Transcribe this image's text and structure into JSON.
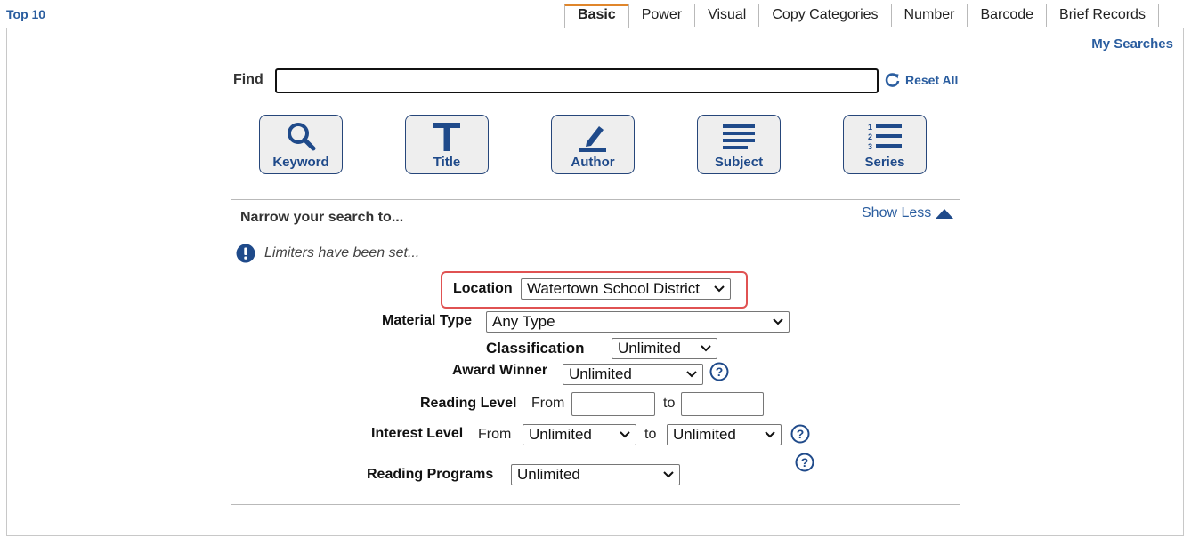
{
  "header": {
    "top10_label": "Top 10",
    "my_searches_label": "My Searches"
  },
  "tabs": [
    {
      "label": "Basic",
      "active": true
    },
    {
      "label": "Power"
    },
    {
      "label": "Visual"
    },
    {
      "label": "Copy Categories"
    },
    {
      "label": "Number"
    },
    {
      "label": "Barcode"
    },
    {
      "label": "Brief Records"
    }
  ],
  "find": {
    "label": "Find",
    "value": "",
    "reset_label": "Reset All"
  },
  "search_buttons": [
    {
      "label": "Keyword",
      "icon": "magnifier-icon"
    },
    {
      "label": "Title",
      "icon": "title-t-icon"
    },
    {
      "label": "Author",
      "icon": "pencil-icon"
    },
    {
      "label": "Subject",
      "icon": "lines-icon"
    },
    {
      "label": "Series",
      "icon": "numbered-list-icon"
    }
  ],
  "narrow": {
    "title": "Narrow your search to...",
    "show_less_label": "Show Less",
    "limiters_note": "Limiters have been set...",
    "location": {
      "label": "Location",
      "value": "Watertown School District"
    },
    "material_type": {
      "label": "Material Type",
      "value": "Any Type"
    },
    "classification": {
      "label": "Classification",
      "value": "Unlimited"
    },
    "award_winner": {
      "label": "Award Winner",
      "value": "Unlimited"
    },
    "reading_level": {
      "label": "Reading Level",
      "from_label": "From",
      "to_label": "to",
      "from_value": "",
      "to_value": ""
    },
    "interest_level": {
      "label": "Interest Level",
      "from_label": "From",
      "to_label": "to",
      "from_value": "Unlimited",
      "to_value": "Unlimited"
    },
    "reading_programs": {
      "label": "Reading Programs",
      "value": "Unlimited"
    }
  },
  "colors": {
    "link_blue": "#2a5d9f",
    "active_tab_accent": "#e0862b",
    "highlight_red": "#e05252",
    "button_navy": "#1f4a8a"
  }
}
